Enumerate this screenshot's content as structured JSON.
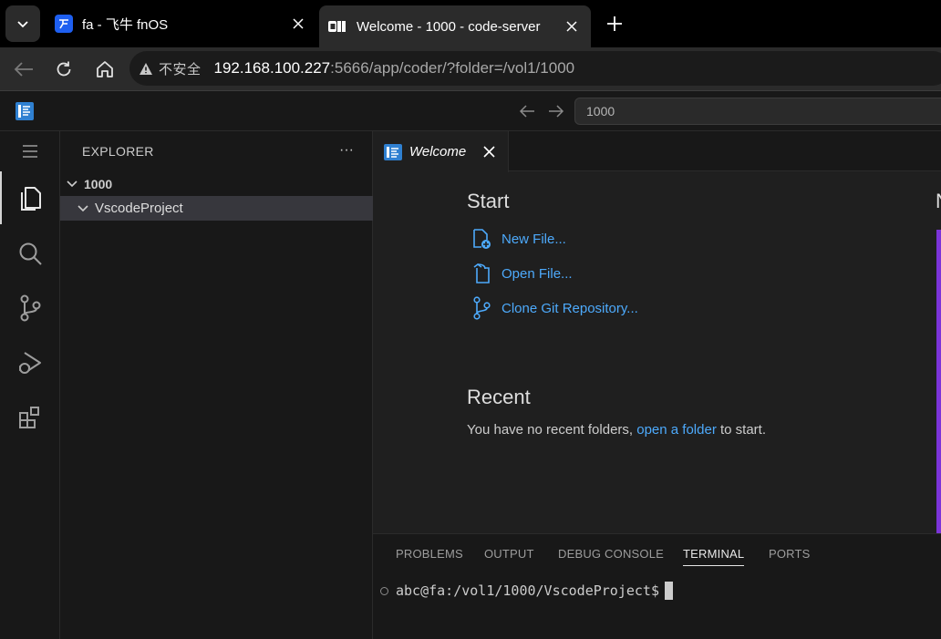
{
  "browser": {
    "tabs": [
      {
        "title": "fa - 飞牛 fnOS"
      },
      {
        "title": "Welcome - 1000 - code-server"
      }
    ],
    "address": {
      "security_label": "不安全",
      "host": "192.168.100.227",
      "rest": ":5666/app/coder/?folder=/vol1/1000"
    }
  },
  "vscode": {
    "command_center": "1000",
    "sidebar": {
      "title": "EXPLORER",
      "more": "···",
      "folder": "1000",
      "project": "VscodeProject"
    },
    "editor_tab": "Welcome",
    "welcome": {
      "start_heading": "Start",
      "links": [
        "New File...",
        "Open File...",
        "Clone Git Repository..."
      ],
      "recent_heading": "Recent",
      "recent_prefix": "You have no recent folders,",
      "recent_link": "open a folder",
      "recent_suffix": "to start.",
      "edge_char": "N"
    },
    "panel": {
      "tabs": [
        "PROBLEMS",
        "OUTPUT",
        "DEBUG CONSOLE",
        "TERMINAL",
        "PORTS"
      ],
      "active_tab": "TERMINAL",
      "terminal_prompt": "abc@fa:/vol1/1000/VscodeProject$"
    }
  },
  "colors": {
    "accent_link": "#4daafc",
    "vscode_logo": "#2f80d1",
    "fnos_icon": "#1e5ff0",
    "edge_bar": "#7b34d8"
  }
}
